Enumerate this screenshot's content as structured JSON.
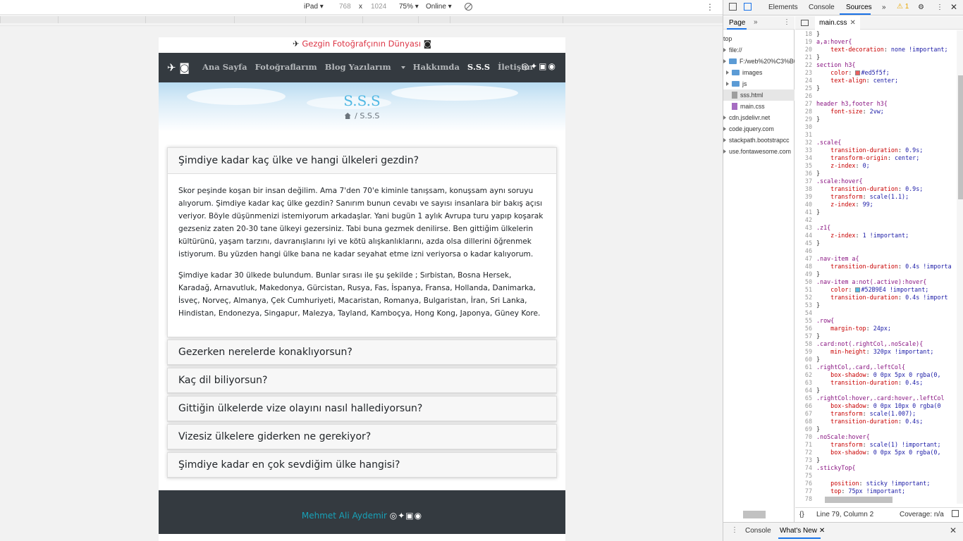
{
  "device_toolbar": {
    "device": "iPad",
    "width": "768",
    "times": "x",
    "height": "1024",
    "zoom": "75%",
    "network": "Online"
  },
  "site": {
    "brand": "Gezgin Fotoğrafçının Dünyası",
    "nav": [
      "Ana Sayfa",
      "Fotoğraflarım",
      "Blog Yazılarım",
      "Hakkımda",
      "S.S.S",
      "İletişim"
    ],
    "active_nav": "S.S.S",
    "hero_title": "S.S.S",
    "breadcrumb_sep": "/",
    "breadcrumb_current": "S.S.S",
    "faq": [
      {
        "question": "Şimdiye kadar kaç ülke ve hangi ülkeleri gezdin?",
        "open": true,
        "paragraphs": [
          "Skor peşinde koşan bir insan değilim. Ama 7'den 70'e kiminle tanışsam, konuşsam aynı soruyu alıyorum. Şimdiye kadar kaç ülke gezdin? Sanırım bunun cevabı ve sayısı insanlara bir bakış açısı veriyor. Böyle düşünmenizi istemiyorum arkadaşlar. Yani bugün 1 aylık Avrupa turu yapıp koşarak gezseniz zaten 20-30 tane ülkeyi gezersiniz. Tabi buna gezmek denilirse. Ben gittiğim ülkelerin kültürünü, yaşam tarzını, davranışlarını iyi ve kötü alışkanlıklarını, azda olsa dillerini öğrenmek istiyorum. Bu yüzden hangi ülke bana ne kadar seyahat etme izni veriyorsa o kadar kalıyorum.",
          "Şimdiye kadar 30 ülkede bulundum. Bunlar sırası ile şu şekilde ; Sırbistan, Bosna Hersek, Karadağ, Arnavutluk, Makedonya, Gürcistan, Rusya, Fas, İspanya, Fransa, Hollanda, Danimarka, İsveç, Norveç, Almanya, Çek Cumhuriyeti, Macaristan, Romanya, Bulgaristan, İran, Sri Lanka, Hindistan, Endonezya, Singapur, Malezya, Tayland, Kamboçya, Hong Kong, Japonya, Güney Kore."
        ]
      },
      {
        "question": "Gezerken nerelerde konaklıyorsun?"
      },
      {
        "question": "Kaç dil biliyorsun?"
      },
      {
        "question": "Gittiğin ülkelerde vize olayını nasıl hallediyorsun?"
      },
      {
        "question": "Vizesiz ülkelere giderken ne gerekiyor?"
      },
      {
        "question": "Şimdiye kadar en çok sevdiğim ülke hangisi?"
      }
    ],
    "footer_name": "Mehmet Ali Aydemir",
    "colors": {
      "accent": "#52b9e4",
      "brand_red": "#dc3545",
      "navbar": "#343a40",
      "footer_link": "#17a2b8"
    }
  },
  "devtools": {
    "tabs": [
      "Elements",
      "Console",
      "Sources"
    ],
    "active_tab": "Sources",
    "more": "»",
    "warnings": "1",
    "nav_tab": "Page",
    "tree": [
      {
        "label": "top",
        "kind": "frame"
      },
      {
        "label": "file://",
        "kind": "origin"
      },
      {
        "label": "F:/web%20%C3%B6",
        "kind": "folder"
      },
      {
        "label": "images",
        "kind": "folder"
      },
      {
        "label": "js",
        "kind": "folder"
      },
      {
        "label": "sss.html",
        "kind": "file"
      },
      {
        "label": "main.css",
        "kind": "css"
      },
      {
        "label": "cdn.jsdelivr.net",
        "kind": "origin"
      },
      {
        "label": "code.jquery.com",
        "kind": "origin"
      },
      {
        "label": "stackpath.bootstrapcc",
        "kind": "origin"
      },
      {
        "label": "use.fontawesome.com",
        "kind": "origin"
      }
    ],
    "open_file": "main.css",
    "code_lines": [
      {
        "n": "18",
        "t": "}"
      },
      {
        "n": "19",
        "t": "a,a:hover{"
      },
      {
        "n": "20",
        "t": "    text-decoration: none !important;"
      },
      {
        "n": "21",
        "t": "}"
      },
      {
        "n": "22",
        "t": "section h3{"
      },
      {
        "n": "23",
        "t": "    color: #ed5f5f;",
        "swatch": "#ed5f5f"
      },
      {
        "n": "24",
        "t": "    text-align: center;"
      },
      {
        "n": "25",
        "t": "}"
      },
      {
        "n": "26",
        "t": ""
      },
      {
        "n": "27",
        "t": "header h3,footer h3{"
      },
      {
        "n": "28",
        "t": "    font-size: 2vw;"
      },
      {
        "n": "29",
        "t": "}"
      },
      {
        "n": "30",
        "t": ""
      },
      {
        "n": "31",
        "t": ""
      },
      {
        "n": "32",
        "t": ".scale{"
      },
      {
        "n": "33",
        "t": "    transition-duration: 0.9s;"
      },
      {
        "n": "34",
        "t": "    transform-origin: center;"
      },
      {
        "n": "35",
        "t": "    z-index: 0;"
      },
      {
        "n": "36",
        "t": "}"
      },
      {
        "n": "37",
        "t": ".scale:hover{"
      },
      {
        "n": "38",
        "t": "    transition-duration: 0.9s;"
      },
      {
        "n": "39",
        "t": "    transform: scale(1.1);"
      },
      {
        "n": "40",
        "t": "    z-index: 99;"
      },
      {
        "n": "41",
        "t": "}"
      },
      {
        "n": "42",
        "t": ""
      },
      {
        "n": "43",
        "t": ".z1{"
      },
      {
        "n": "44",
        "t": "    z-index: 1 !important;"
      },
      {
        "n": "45",
        "t": "}"
      },
      {
        "n": "46",
        "t": ""
      },
      {
        "n": "47",
        "t": ".nav-item a{"
      },
      {
        "n": "48",
        "t": "    transition-duration: 0.4s !importa"
      },
      {
        "n": "49",
        "t": "}"
      },
      {
        "n": "50",
        "t": ".nav-item a:not(.active):hover{"
      },
      {
        "n": "51",
        "t": "    color: #52B9E4 !important;",
        "swatch": "#52B9E4"
      },
      {
        "n": "52",
        "t": "    transition-duration: 0.4s !import"
      },
      {
        "n": "53",
        "t": "}"
      },
      {
        "n": "54",
        "t": ""
      },
      {
        "n": "55",
        "t": ".row{"
      },
      {
        "n": "56",
        "t": "    margin-top: 24px;"
      },
      {
        "n": "57",
        "t": "}"
      },
      {
        "n": "58",
        "t": ".card:not(.rightCol,.noScale){"
      },
      {
        "n": "59",
        "t": "    min-height: 320px !important;"
      },
      {
        "n": "60",
        "t": "}"
      },
      {
        "n": "61",
        "t": ".rightCol,.card,.leftCol{"
      },
      {
        "n": "62",
        "t": "    box-shadow: 0 0px 5px 0 rgba(0,"
      },
      {
        "n": "63",
        "t": "    transition-duration: 0.4s;"
      },
      {
        "n": "64",
        "t": "}"
      },
      {
        "n": "65",
        "t": ".rightCol:hover,.card:hover,.leftCol"
      },
      {
        "n": "66",
        "t": "    box-shadow: 0 0px 10px 0 rgba(0"
      },
      {
        "n": "67",
        "t": "    transform: scale(1.007);"
      },
      {
        "n": "68",
        "t": "    transition-duration: 0.4s;"
      },
      {
        "n": "69",
        "t": "}"
      },
      {
        "n": "70",
        "t": ".noScale:hover{"
      },
      {
        "n": "71",
        "t": "    transform: scale(1) !important;"
      },
      {
        "n": "72",
        "t": "    box-shadow: 0 0px 5px 0 rgba(0,"
      },
      {
        "n": "73",
        "t": "}"
      },
      {
        "n": "74",
        "t": ".stickyTop{"
      },
      {
        "n": "75",
        "t": ""
      },
      {
        "n": "76",
        "t": "    position: sticky !important;"
      },
      {
        "n": "77",
        "t": "    top:75px !important;"
      },
      {
        "n": "78",
        "t": ""
      }
    ],
    "status_position": "Line 79, Column 2",
    "status_coverage": "Coverage: n/a",
    "status_icon": "{}",
    "drawer_tabs": [
      "Console",
      "What's New"
    ],
    "drawer_active": "What's New"
  }
}
